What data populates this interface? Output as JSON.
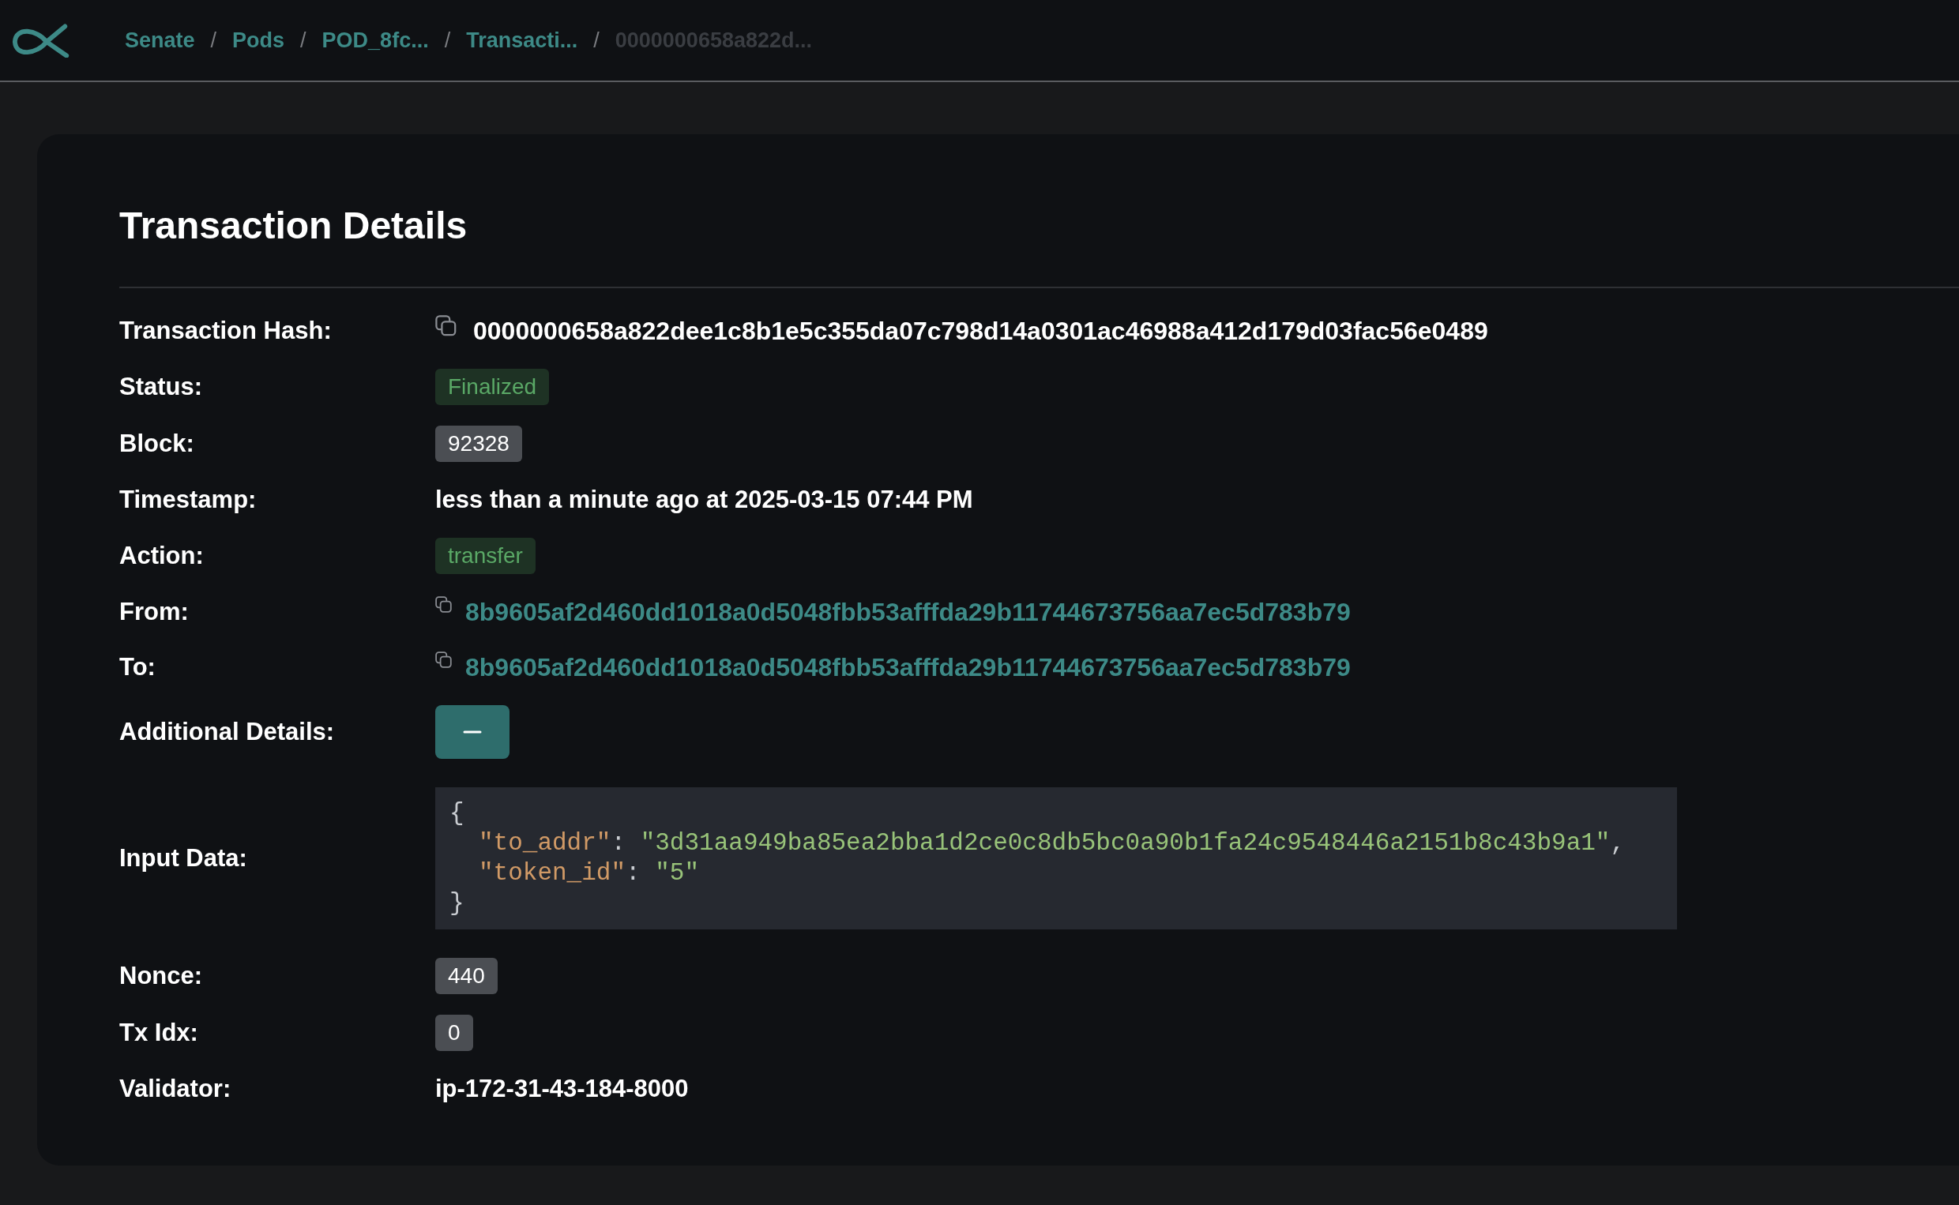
{
  "breadcrumbs": [
    {
      "label": "Senate",
      "current": false
    },
    {
      "label": "Pods",
      "current": false
    },
    {
      "label": "POD_8fc...",
      "current": false
    },
    {
      "label": "Transacti...",
      "current": false
    },
    {
      "label": "0000000658a822d...",
      "current": true
    }
  ],
  "breadcrumb_separator": "/",
  "title": "Transaction Details",
  "fields": [
    {
      "label": "Transaction Hash:",
      "kind": "hash",
      "value": "0000000658a822dee1c8b1e5c355da07c798d14a0301ac46988a412d179d03fac56e0489"
    },
    {
      "label": "Status:",
      "kind": "tag",
      "value": "Finalized"
    },
    {
      "label": "Block:",
      "kind": "number",
      "value": "92328"
    },
    {
      "label": "Timestamp:",
      "kind": "text",
      "value": "less than a minute ago at 2025-03-15 07:44 PM"
    },
    {
      "label": "Action:",
      "kind": "tag",
      "value": "transfer"
    },
    {
      "label": "From:",
      "kind": "address",
      "value": "8b9605af2d460dd1018a0d5048fbb53afffda29b11744673756aa7ec5d783b79"
    },
    {
      "label": "To:",
      "kind": "address",
      "value": "8b9605af2d460dd1018a0d5048fbb53afffda29b11744673756aa7ec5d783b79"
    },
    {
      "label": "Additional Details:",
      "kind": "toggle",
      "expanded": true
    },
    {
      "label": "Input Data:",
      "kind": "code",
      "open": "{",
      "close": "}",
      "entries": [
        {
          "key": "\"to_addr\"",
          "sep": ":",
          "value": "\"3d31aa949ba85ea2bba1d2ce0c8db5bc0a90b1fa24c9548446a2151b8c43b9a1\"",
          "trail": ","
        },
        {
          "key": "\"token_id\"",
          "sep": ":",
          "value": "\"5\""
        }
      ]
    },
    {
      "label": "Nonce:",
      "kind": "number",
      "value": "440"
    },
    {
      "label": "Tx Idx:",
      "kind": "number",
      "value": "0"
    },
    {
      "label": "Validator:",
      "kind": "text",
      "value": "ip-172-31-43-184-8000"
    }
  ]
}
